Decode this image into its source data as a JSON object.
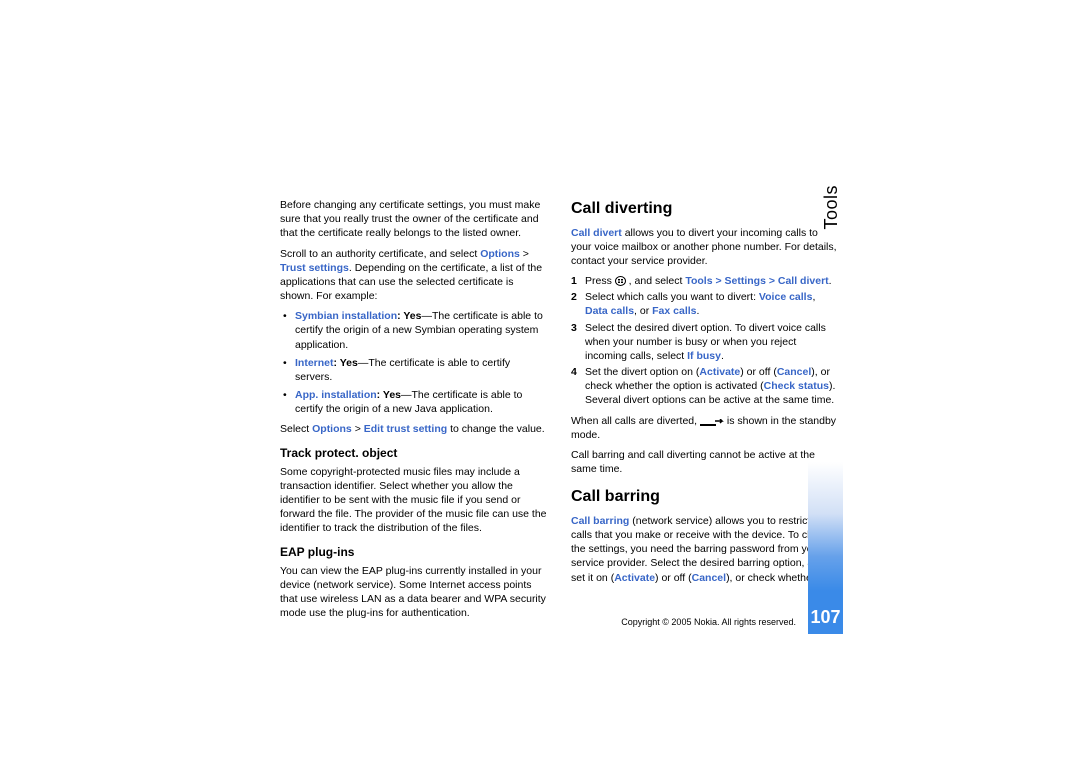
{
  "sidebar": {
    "label": "Tools"
  },
  "page_number": "107",
  "copyright": "Copyright © 2005 Nokia. All rights reserved.",
  "left": {
    "p1": "Before changing any certificate settings, you must make sure that you really trust the owner of the certificate and that the certificate really belongs to the listed owner.",
    "p2a": "Scroll to an authority certificate, and select ",
    "p2_link1": "Options",
    "p2_gt": " > ",
    "p2_link2": "Trust settings",
    "p2b": ". Depending on the certificate, a list of the applications that can use the selected certificate is shown. For example:",
    "b1_label": "Symbian installation",
    "b1_val": ": Yes",
    "b1_rest": "—The certificate is able to certify the origin of a new Symbian operating system application.",
    "b2_label": "Internet",
    "b2_val": ": Yes",
    "b2_rest": "—The certificate is able to certify servers.",
    "b3_label": "App. installation",
    "b3_val": ": Yes",
    "b3_rest": "—The certificate is able to certify the origin of a new Java application.",
    "p3a": "Select ",
    "p3_link1": "Options",
    "p3_gt": " > ",
    "p3_link2": "Edit trust setting",
    "p3b": " to change the value.",
    "h3a": "Track protect. object",
    "p4": "Some copyright-protected music files may include a transaction identifier. Select whether you allow the identifier to be sent with the music file if you send or forward the file. The provider of the music file can use the identifier to track the distribution of the files.",
    "h3b": "EAP plug-ins",
    "p5": "You can view the EAP plug-ins currently installed in your device (network service). Some Internet access points that use wireless LAN as a data bearer and WPA security mode use the plug-ins for authentication."
  },
  "right": {
    "h2a": "Call diverting",
    "p1_link": "Call divert",
    "p1_rest": " allows you to divert your incoming calls to your voice mailbox or another phone number. For details, contact your service provider.",
    "s1a": "Press ",
    "s1b": " , and select ",
    "s1_link": "Tools > Settings > Call divert",
    "s1c": ".",
    "s2a": "Select which calls you want to divert: ",
    "s2_l1": "Voice calls",
    "s2_c1": ", ",
    "s2_l2": "Data calls",
    "s2_c2": ", or ",
    "s2_l3": "Fax calls",
    "s2_c3": ".",
    "s3a": "Select the desired divert option. To divert voice calls when your number is busy or when you reject incoming calls, select ",
    "s3_link": "If busy",
    "s3b": ".",
    "s4a": "Set the divert option on (",
    "s4_l1": "Activate",
    "s4_m1": ") or off (",
    "s4_l2": "Cancel",
    "s4_m2": "), or check whether the option is activated (",
    "s4_l3": "Check status",
    "s4_m3": "). Several divert options can be active at the same time.",
    "p2a": "When all calls are diverted, ",
    "p2b": " is shown in the standby mode.",
    "p3": "Call barring and call diverting cannot be active at the same time.",
    "h2b": "Call barring",
    "p4_link": "Call barring",
    "p4a": " (network service) allows you to restrict the calls that you make or receive with the device. To change the settings, you need the barring password from your service provider. Select the desired barring option, and set it on (",
    "p4_l1": "Activate",
    "p4_m1": ") or off (",
    "p4_l2": "Cancel",
    "p4_m2": "), or check whether the"
  }
}
